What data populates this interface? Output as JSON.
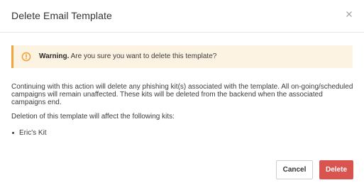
{
  "dialog": {
    "title": "Delete Email Template",
    "close_icon": "close-icon"
  },
  "warning": {
    "icon": "warning-circle-icon",
    "label": "Warning.",
    "message": "Are you sure you want to delete this template?",
    "accent_color": "#f0a43b",
    "background_color": "#fdf3e3"
  },
  "body": {
    "paragraph1": "Continuing with this action will delete any phishing kit(s) associated with the template. All on-going/scheduled campaigns will remain unaffected. These kits will be deleted from the backend when the associated campaigns end.",
    "paragraph2": "Deletion of this template will affect the following kits:",
    "kits": [
      "Eric's Kit"
    ]
  },
  "footer": {
    "cancel_label": "Cancel",
    "delete_label": "Delete",
    "delete_color": "#d9534f"
  }
}
